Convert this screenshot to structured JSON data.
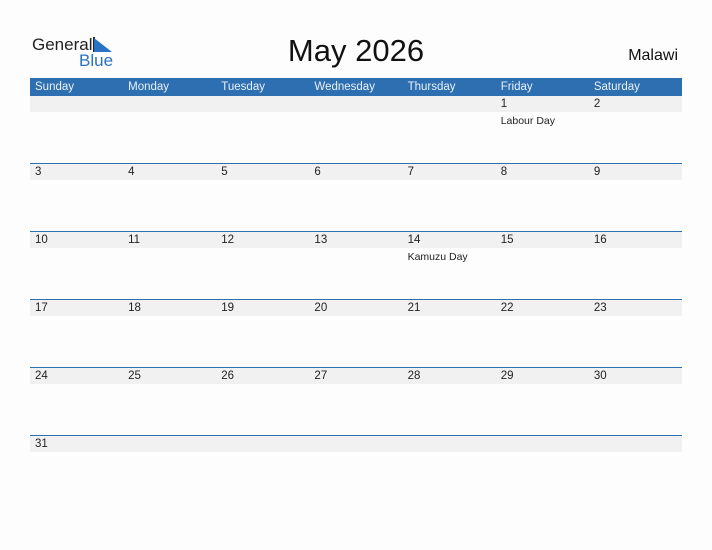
{
  "brand": {
    "line1": "General",
    "line2": "Blue",
    "accent": "#2a73c4"
  },
  "title": "May 2026",
  "country": "Malawi",
  "colors": {
    "header_bg": "#2d6fb0",
    "band_bg": "#f1f1f1"
  },
  "weekdays": [
    "Sunday",
    "Monday",
    "Tuesday",
    "Wednesday",
    "Thursday",
    "Friday",
    "Saturday"
  ],
  "weeks": [
    [
      {
        "d": ""
      },
      {
        "d": ""
      },
      {
        "d": ""
      },
      {
        "d": ""
      },
      {
        "d": ""
      },
      {
        "d": "1",
        "h": "Labour Day"
      },
      {
        "d": "2"
      }
    ],
    [
      {
        "d": "3"
      },
      {
        "d": "4"
      },
      {
        "d": "5"
      },
      {
        "d": "6"
      },
      {
        "d": "7"
      },
      {
        "d": "8"
      },
      {
        "d": "9"
      }
    ],
    [
      {
        "d": "10"
      },
      {
        "d": "11"
      },
      {
        "d": "12"
      },
      {
        "d": "13"
      },
      {
        "d": "14",
        "h": "Kamuzu Day"
      },
      {
        "d": "15"
      },
      {
        "d": "16"
      }
    ],
    [
      {
        "d": "17"
      },
      {
        "d": "18"
      },
      {
        "d": "19"
      },
      {
        "d": "20"
      },
      {
        "d": "21"
      },
      {
        "d": "22"
      },
      {
        "d": "23"
      }
    ],
    [
      {
        "d": "24"
      },
      {
        "d": "25"
      },
      {
        "d": "26"
      },
      {
        "d": "27"
      },
      {
        "d": "28"
      },
      {
        "d": "29"
      },
      {
        "d": "30"
      }
    ],
    [
      {
        "d": "31"
      },
      {
        "d": ""
      },
      {
        "d": ""
      },
      {
        "d": ""
      },
      {
        "d": ""
      },
      {
        "d": ""
      },
      {
        "d": ""
      }
    ]
  ]
}
